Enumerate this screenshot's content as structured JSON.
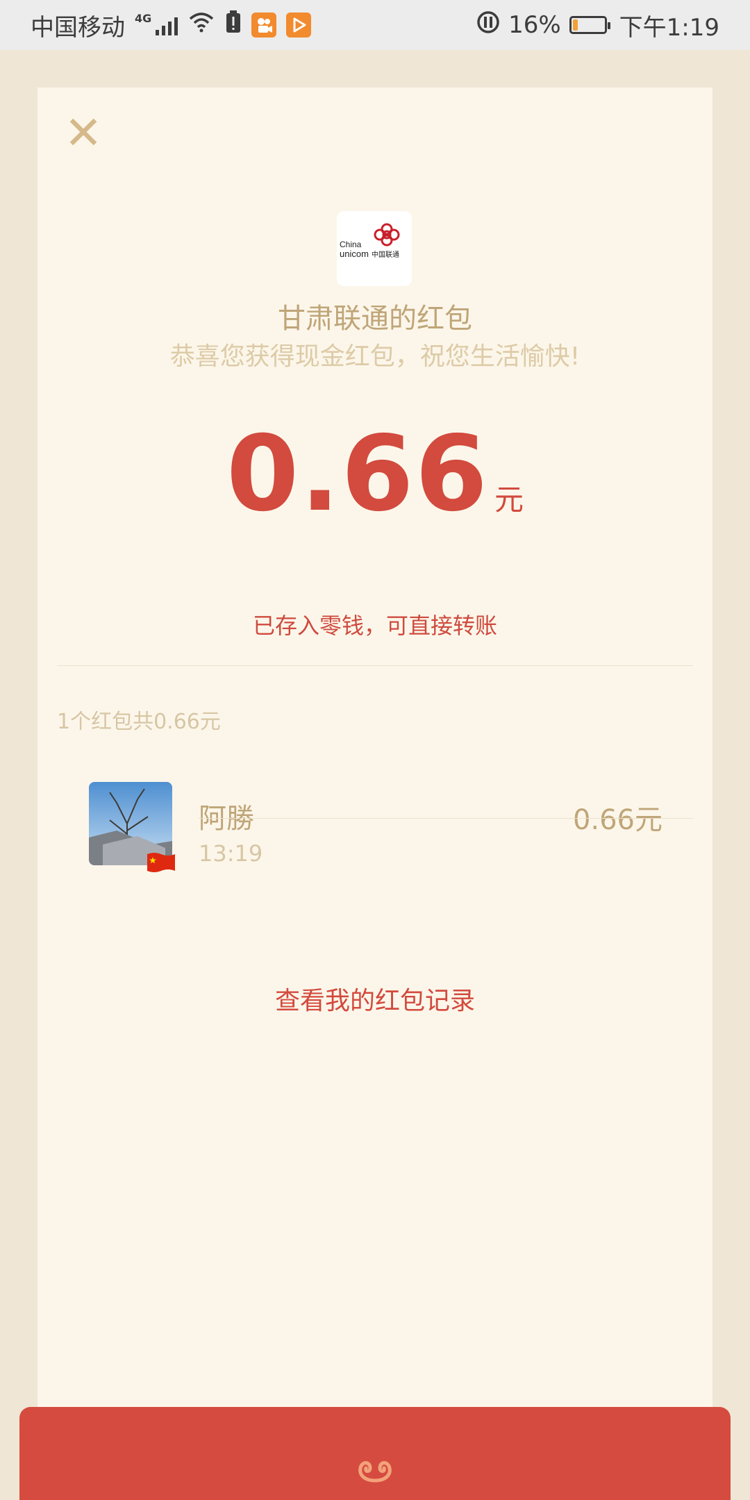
{
  "status_bar": {
    "carrier": "中国移动",
    "network": "4G",
    "battery_percent": "16%",
    "battery_level": 0.16,
    "time": "下午1:19",
    "icons": [
      "signal-icon",
      "wifi-icon",
      "alert-icon",
      "kuaishou-icon",
      "video-icon",
      "data-saver-icon",
      "battery-icon"
    ]
  },
  "envelope": {
    "sender_title": "甘肃联通的红包",
    "greeting": "恭喜您获得现金红包，祝您生活愉快!",
    "logo_text_en_1": "China",
    "logo_text_en_2": "unicom",
    "logo_text_cn": "中国联通",
    "amount": "0.66",
    "amount_unit": "元",
    "deposit_note": "已存入零钱，可直接转账",
    "summary": "1个红包共0.66元",
    "receiver": {
      "name": "阿勝",
      "time": "13:19",
      "amount": "0.66元"
    },
    "history_link": "查看我的红包记录"
  },
  "colors": {
    "accent_red": "#d34a3e",
    "gold_text": "#bfa578",
    "card_bg": "#fcf6ea",
    "page_bg": "#efe6d5"
  }
}
